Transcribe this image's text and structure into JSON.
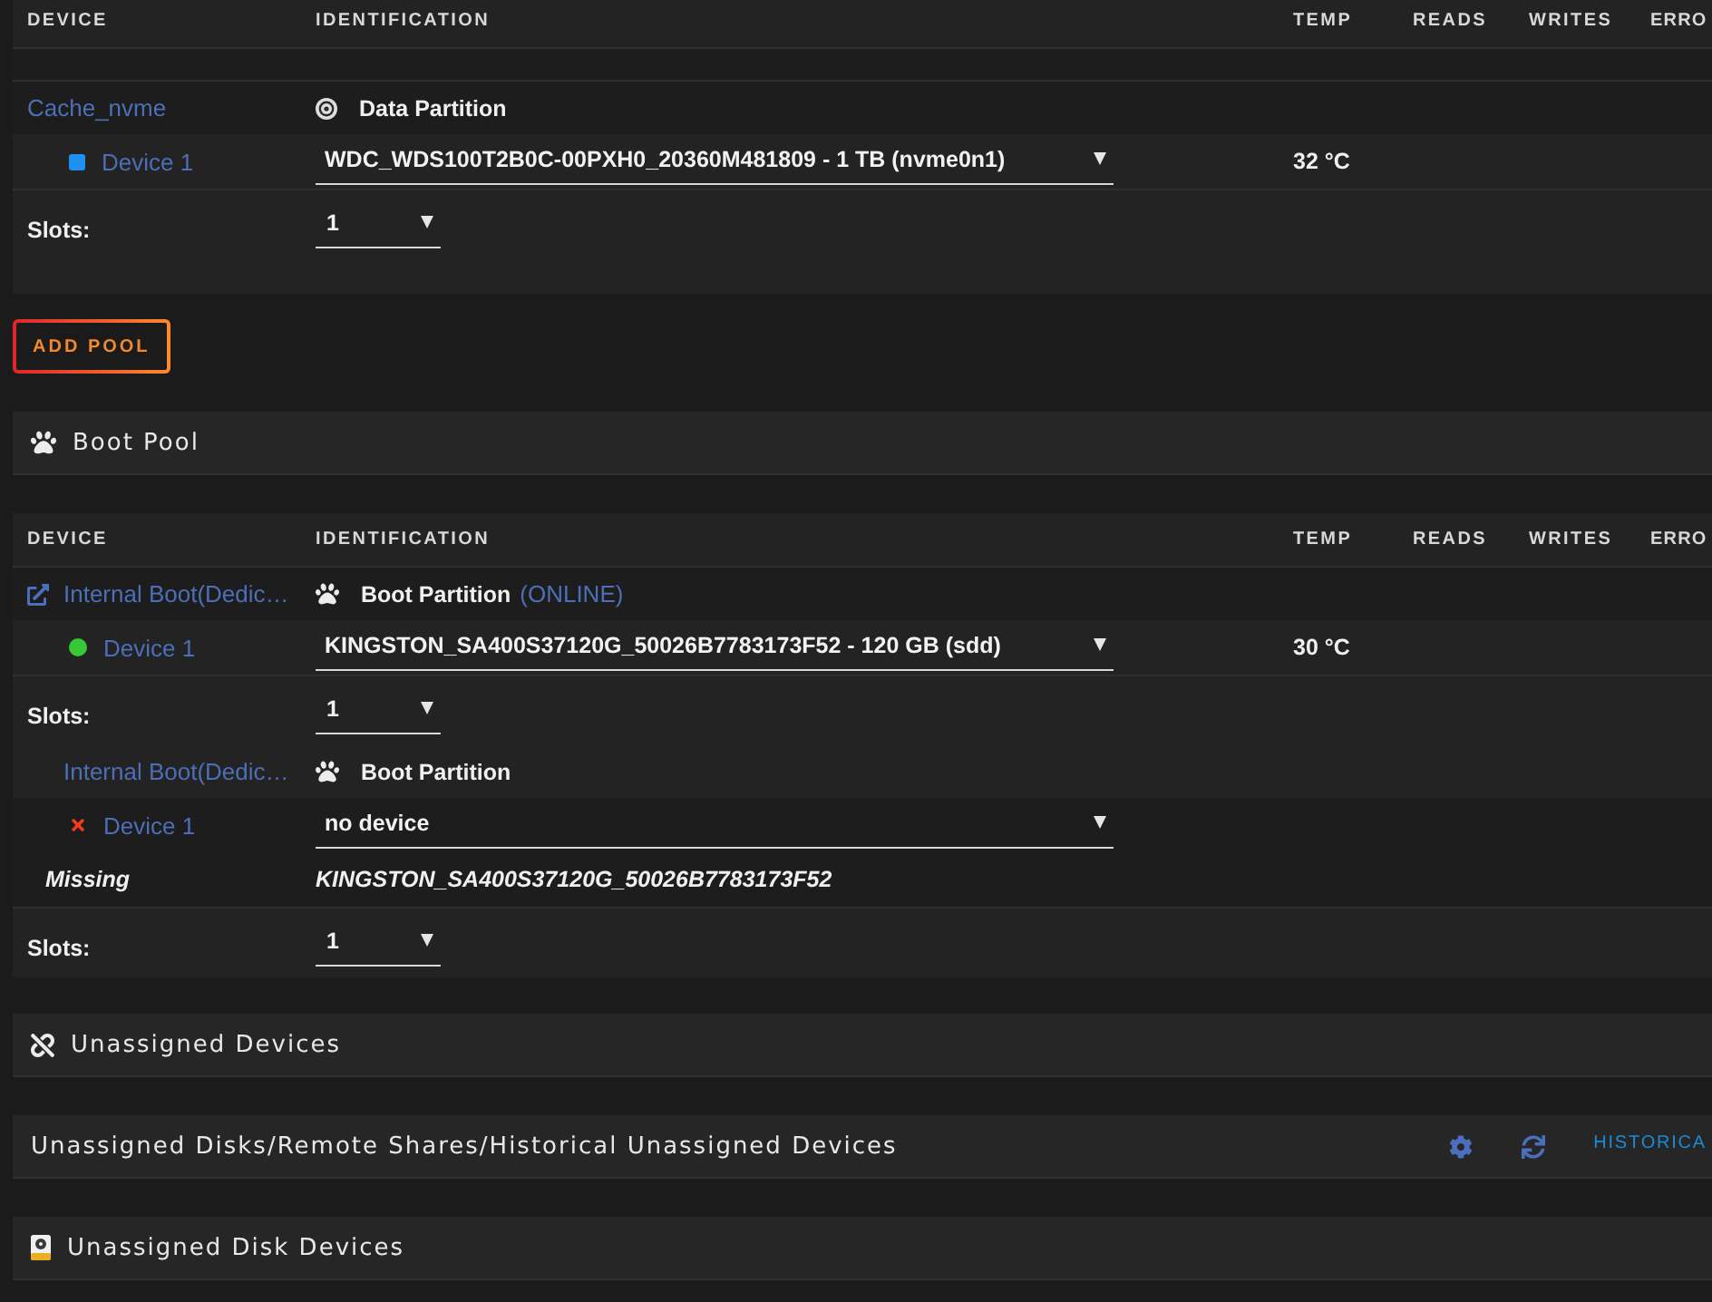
{
  "pool_table": {
    "columns": [
      "DEVICE",
      "IDENTIFICATION",
      "TEMP",
      "READS",
      "WRITES",
      "ERRO"
    ],
    "pools": [
      {
        "name": "Cache_nvme",
        "external_link": false,
        "kind": "data",
        "partition": "Data Partition",
        "devices": [
          {
            "name": "Device 1",
            "kind": "new",
            "identification": "WDC_WDS100T2B0C-00PXH0_20360M481809 - 1 TB (nvme0n1)",
            "temp": "32 °C"
          }
        ],
        "slots_label": "Slots:",
        "slots": "1"
      }
    ]
  },
  "add_pool_button": "ADD POOL",
  "boot_pool": {
    "title": "Boot Pool",
    "columns": [
      "DEVICE",
      "IDENTIFICATION",
      "TEMP",
      "READS",
      "WRITES",
      "ERRO"
    ],
    "pools": [
      {
        "name": "Internal Boot(Dedic…",
        "external_link": true,
        "kind": "boot",
        "partition": "Boot Partition",
        "partition_state": "(ONLINE)",
        "devices": [
          {
            "name": "Device 1",
            "kind": "online",
            "identification": "KINGSTON_SA400S37120G_50026B7783173F52 - 120 GB (sdd)",
            "temp": "30 °C"
          }
        ],
        "slots_label": "Slots:",
        "slots": "1"
      },
      {
        "name": "Internal Boot(Dedic…",
        "external_link": false,
        "kind": "boot",
        "partition": "Boot Partition",
        "devices": [
          {
            "name": "Device 1",
            "kind": "missing",
            "identification": "no device",
            "missing_label": "Missing",
            "missing_id": "KINGSTON_SA400S37120G_50026B7783173F52"
          }
        ],
        "slots_label": "Slots:",
        "slots": "1"
      }
    ]
  },
  "sections": [
    {
      "kind": "unassigned",
      "title": "Unassigned Devices"
    },
    {
      "kind": "toolbar",
      "title": "Unassigned Disks/Remote Shares/Historical Unassigned Devices",
      "link": "HISTORICA"
    },
    {
      "kind": "disks",
      "title": "Unassigned Disk Devices"
    }
  ]
}
